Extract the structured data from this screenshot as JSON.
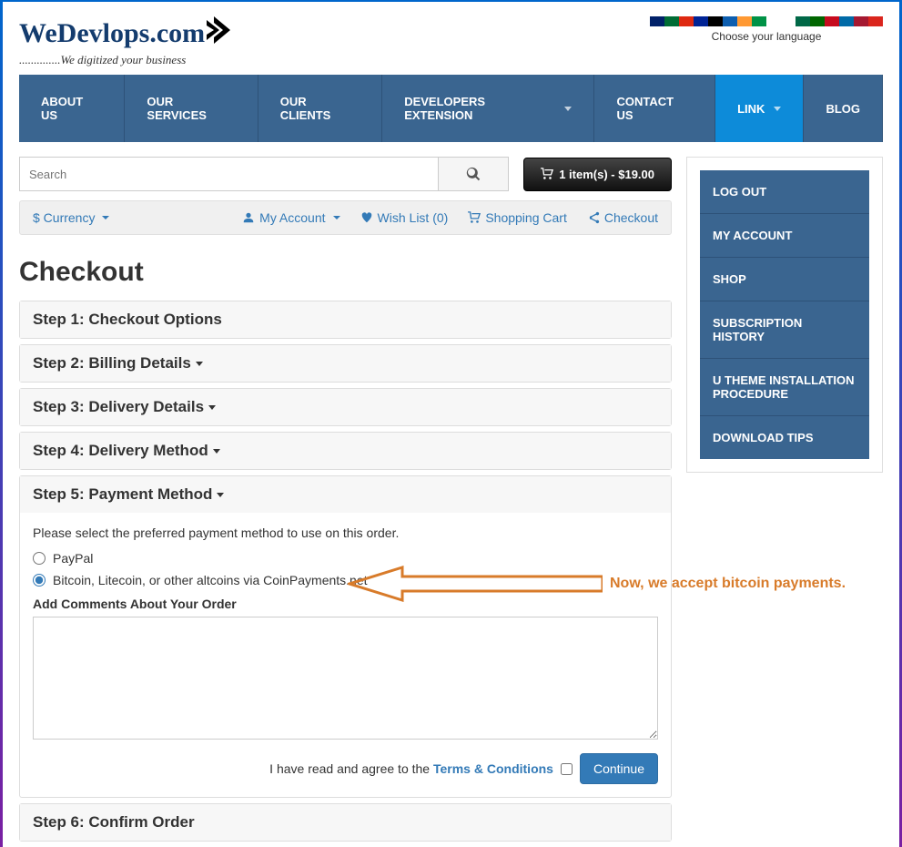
{
  "logo": {
    "text": "WeDevlops.com",
    "tagline": "..............We digitized your business"
  },
  "language": {
    "label": "Choose your language",
    "flags": [
      {
        "name": "en",
        "bg": "#012169"
      },
      {
        "name": "ar",
        "bg": "#006c35"
      },
      {
        "name": "zh",
        "bg": "#de2910"
      },
      {
        "name": "fr",
        "bg": "#002395"
      },
      {
        "name": "de",
        "bg": "#000"
      },
      {
        "name": "el",
        "bg": "#0d5eaf"
      },
      {
        "name": "hi",
        "bg": "#ff9933"
      },
      {
        "name": "it",
        "bg": "#009246"
      },
      {
        "name": "ja",
        "bg": "#fff"
      },
      {
        "name": "ko",
        "bg": "#fff"
      },
      {
        "name": "es-mx",
        "bg": "#006847"
      },
      {
        "name": "pt",
        "bg": "#006600"
      },
      {
        "name": "es",
        "bg": "#c60b1e"
      },
      {
        "name": "sv",
        "bg": "#006aa7"
      },
      {
        "name": "th",
        "bg": "#a51931"
      },
      {
        "name": "vi",
        "bg": "#da251d"
      }
    ]
  },
  "nav": {
    "items": [
      {
        "label": "ABOUT US",
        "dropdown": false,
        "active": false
      },
      {
        "label": "OUR SERVICES",
        "dropdown": false,
        "active": false
      },
      {
        "label": "OUR CLIENTS",
        "dropdown": false,
        "active": false
      },
      {
        "label": "DEVELOPERS EXTENSION",
        "dropdown": true,
        "active": false
      },
      {
        "label": "CONTACT US",
        "dropdown": false,
        "active": false
      },
      {
        "label": "LINK",
        "dropdown": true,
        "active": true
      },
      {
        "label": "BLOG",
        "dropdown": false,
        "active": false
      }
    ]
  },
  "search": {
    "placeholder": "Search"
  },
  "cart": {
    "label": "1 item(s) - $19.00"
  },
  "util": {
    "currency": "$ Currency",
    "account": "My Account",
    "wishlist": "Wish List (0)",
    "shopping": "Shopping Cart",
    "checkout": "Checkout"
  },
  "page_title": "Checkout",
  "steps": {
    "s1": "Step 1: Checkout Options",
    "s2": "Step 2: Billing Details",
    "s3": "Step 3: Delivery Details",
    "s4": "Step 4: Delivery Method",
    "s5": "Step 5: Payment Method",
    "s6": "Step 6: Confirm Order"
  },
  "payment": {
    "intro": "Please select the preferred payment method to use on this order.",
    "opt_paypal": "PayPal",
    "opt_bitcoin": "Bitcoin, Litecoin, or other altcoins via CoinPayments.net",
    "comments_label": "Add Comments About Your Order",
    "agree_pre": "I have read and agree to the ",
    "agree_link": "Terms & Conditions",
    "continue": "Continue"
  },
  "sidebar": {
    "items": [
      {
        "label": "LOG OUT"
      },
      {
        "label": "MY ACCOUNT"
      },
      {
        "label": "SHOP"
      },
      {
        "label": "SUBSCRIPTION HISTORY"
      },
      {
        "label": "U THEME INSTALLATION PROCEDURE"
      },
      {
        "label": "DOWNLOAD TIPS"
      }
    ]
  },
  "annotation": {
    "text": "Now, we accept bitcoin payments."
  }
}
